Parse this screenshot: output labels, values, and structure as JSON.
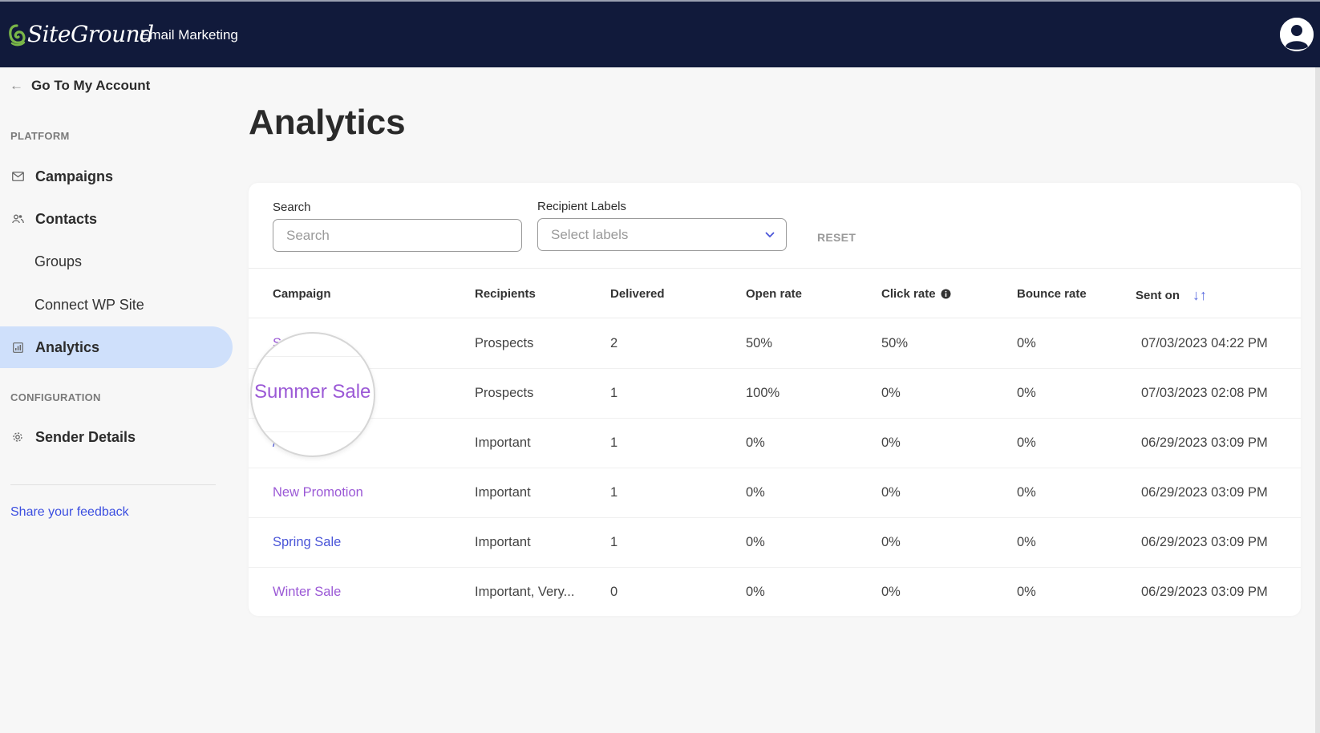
{
  "header": {
    "logo_text": "SiteGround",
    "app_name": "Email Marketing",
    "avatar_icon": "user-circle-icon"
  },
  "sidebar": {
    "back_link": "Go To My Account",
    "sections": [
      {
        "label": "PLATFORM",
        "items": [
          {
            "label": "Campaigns",
            "icon": "envelope-icon"
          },
          {
            "label": "Contacts",
            "icon": "people-icon"
          },
          {
            "label": "Groups"
          },
          {
            "label": "Connect WP Site"
          },
          {
            "label": "Analytics",
            "icon": "chart-icon",
            "active": true
          }
        ]
      },
      {
        "label": "CONFIGURATION",
        "items": [
          {
            "label": "Sender Details",
            "icon": "gear-icon"
          }
        ]
      }
    ],
    "feedback_link": "Share your feedback"
  },
  "page": {
    "title": "Analytics"
  },
  "filters": {
    "search_label": "Search",
    "search_placeholder": "Search",
    "search_value": "",
    "labels_label": "Recipient Labels",
    "labels_placeholder": "Select labels",
    "reset_label": "RESET"
  },
  "table": {
    "columns": [
      "Campaign",
      "Recipients",
      "Delivered",
      "Open rate",
      "Click rate",
      "Bounce rate",
      "Sent on"
    ],
    "rows": [
      {
        "campaign": "S",
        "recipients": "Prospects",
        "delivered": "2",
        "open_rate": "50%",
        "click_rate": "50%",
        "bounce_rate": "0%",
        "sent_on": "07/03/2023 04:22 PM"
      },
      {
        "campaign": "Summer Sale",
        "recipients": "Prospects",
        "delivered": "1",
        "open_rate": "100%",
        "click_rate": "0%",
        "bounce_rate": "0%",
        "sent_on": "07/03/2023 02:08 PM"
      },
      {
        "campaign": "/",
        "recipients": "Important",
        "delivered": "1",
        "open_rate": "0%",
        "click_rate": "0%",
        "bounce_rate": "0%",
        "sent_on": "06/29/2023 03:09 PM"
      },
      {
        "campaign": "New Promotion",
        "recipients": "Important",
        "delivered": "1",
        "open_rate": "0%",
        "click_rate": "0%",
        "bounce_rate": "0%",
        "sent_on": "06/29/2023 03:09 PM"
      },
      {
        "campaign": "Spring Sale",
        "recipients": "Important",
        "delivered": "1",
        "open_rate": "0%",
        "click_rate": "0%",
        "bounce_rate": "0%",
        "sent_on": "06/29/2023 03:09 PM"
      },
      {
        "campaign": "Winter Sale",
        "recipients": "Important, Very...",
        "delivered": "0",
        "open_rate": "0%",
        "click_rate": "0%",
        "bounce_rate": "0%",
        "sent_on": "06/29/2023 03:09 PM"
      }
    ]
  },
  "magnifier": {
    "text": "Summer Sale"
  },
  "colors": {
    "topbar": "#111a3b",
    "active_nav": "#cfe0fb",
    "campaign_link": "#9b59d6",
    "link_blue": "#4a55d8",
    "logo_green": "#7ab648"
  }
}
